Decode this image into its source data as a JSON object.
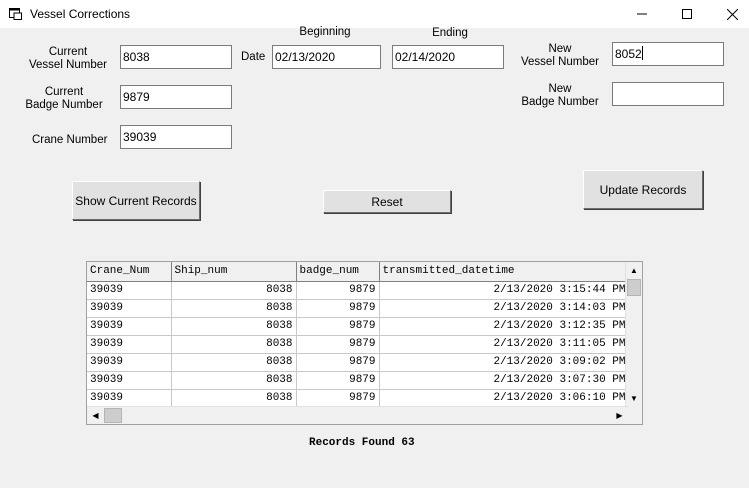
{
  "window": {
    "title": "Vessel Corrections",
    "minimize_glyph": "—",
    "maximize_glyph": "☐",
    "close_glyph": "✕"
  },
  "form": {
    "current_vessel_label_1": "Current",
    "current_vessel_label_2": "Vessel Number",
    "current_vessel_value": "8038",
    "current_badge_label_1": "Current",
    "current_badge_label_2": "Badge Number",
    "current_badge_value": "9879",
    "crane_label": "Crane Number",
    "crane_value": "39039",
    "date_label": "Date",
    "beginning_label": "Beginning",
    "beginning_value": "02/13/2020",
    "ending_label": "Ending",
    "ending_value": "02/14/2020",
    "new_vessel_label_1": "New",
    "new_vessel_label_2": "Vessel Number",
    "new_vessel_value": "8052",
    "new_badge_label_1": "New",
    "new_badge_label_2": "Badge Number",
    "new_badge_value": ""
  },
  "buttons": {
    "show_current": "Show Current Records",
    "reset": "Reset",
    "update": "Update Records"
  },
  "grid": {
    "columns": [
      "Crane_Num",
      "Ship_num",
      "badge_num",
      "transmitted_datetime"
    ],
    "rows": [
      [
        "39039",
        "8038",
        "9879",
        "2/13/2020  3:15:44 PM"
      ],
      [
        "39039",
        "8038",
        "9879",
        "2/13/2020  3:14:03 PM"
      ],
      [
        "39039",
        "8038",
        "9879",
        "2/13/2020  3:12:35 PM"
      ],
      [
        "39039",
        "8038",
        "9879",
        "2/13/2020  3:11:05 PM"
      ],
      [
        "39039",
        "8038",
        "9879",
        "2/13/2020  3:09:02 PM"
      ],
      [
        "39039",
        "8038",
        "9879",
        "2/13/2020  3:07:30 PM"
      ],
      [
        "39039",
        "8038",
        "9879",
        "2/13/2020  3:06:10 PM"
      ]
    ]
  },
  "status": {
    "records_found": "Records Found 63"
  },
  "icons": {
    "app": "app-window-icon",
    "scroll_up": "▲",
    "scroll_down": "▼",
    "scroll_left": "◀",
    "scroll_right": "▶"
  }
}
